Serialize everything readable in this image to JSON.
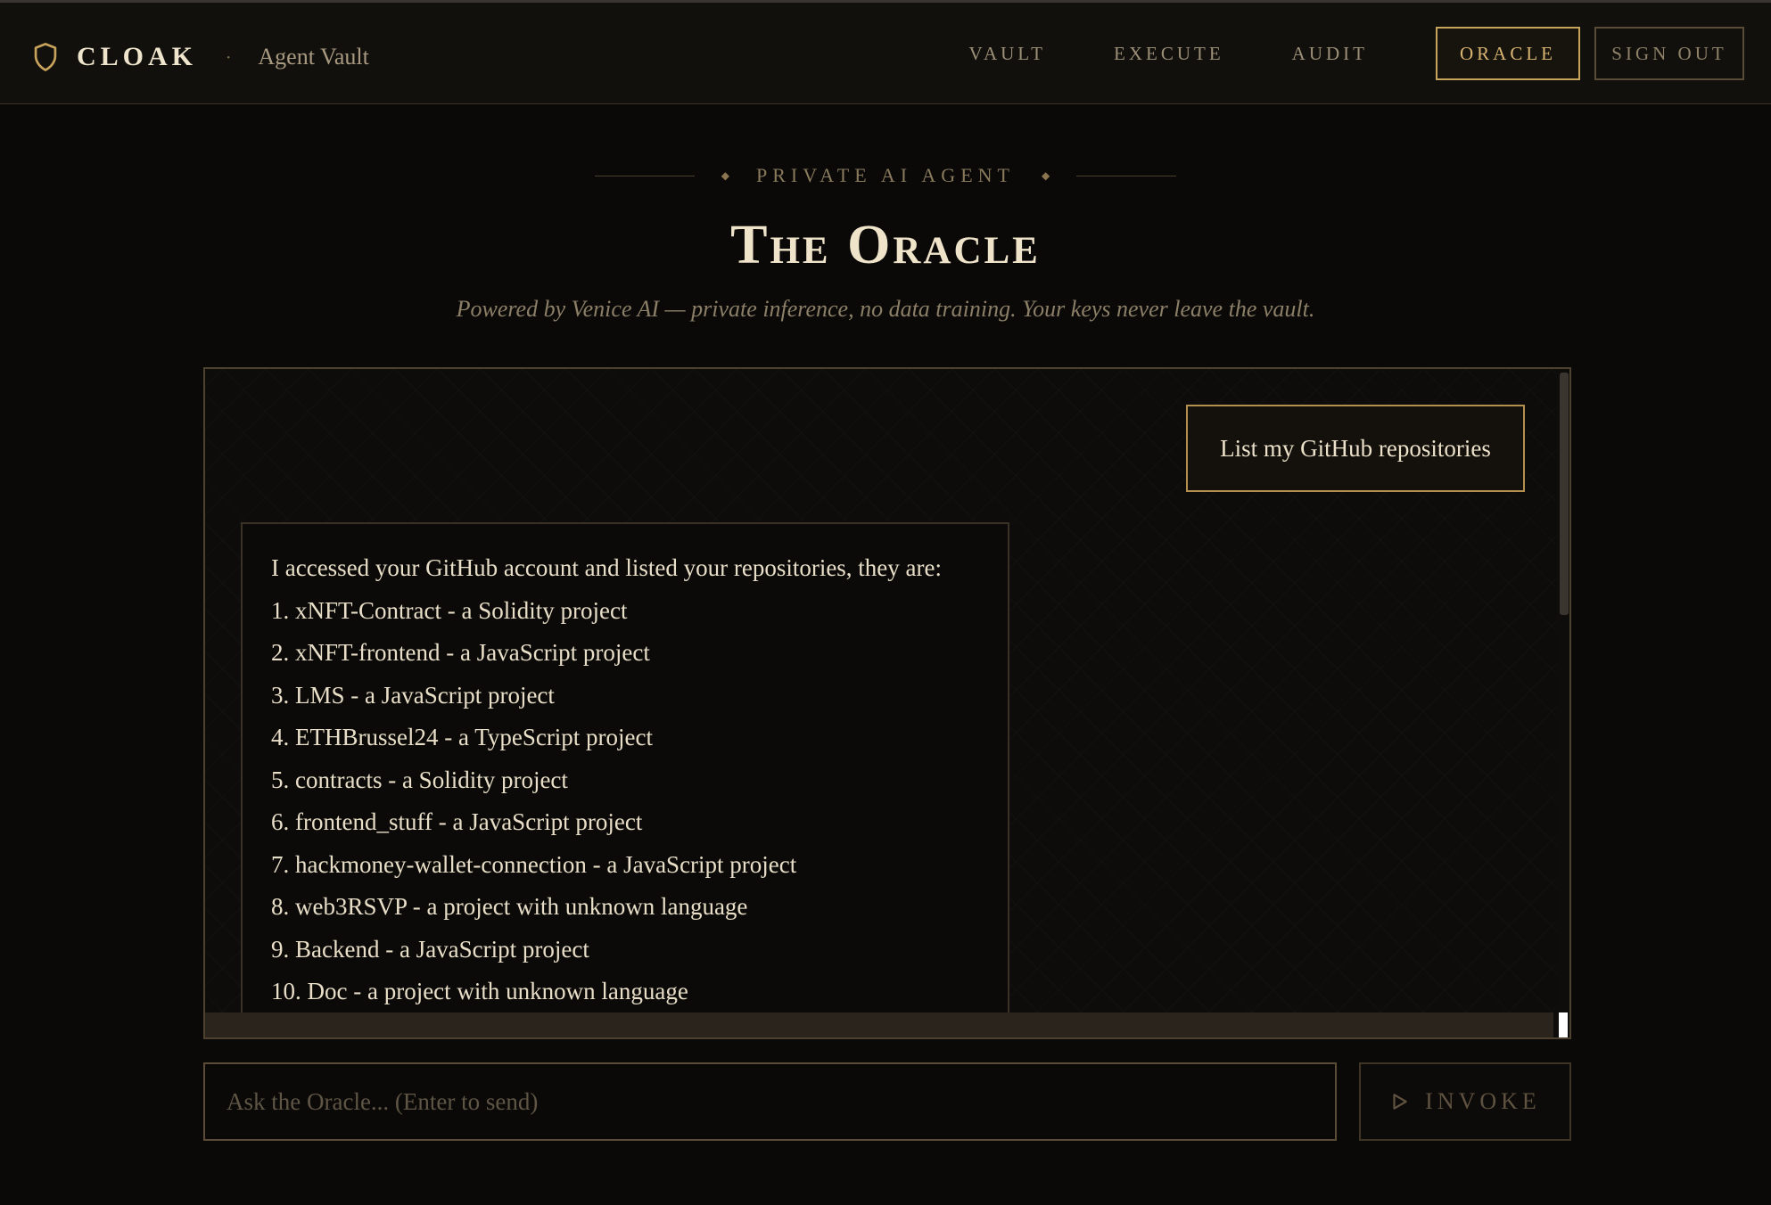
{
  "brand": {
    "name": "CLOAK",
    "separator": "·",
    "subtitle": "Agent Vault"
  },
  "nav": {
    "items": [
      "VAULT",
      "EXECUTE",
      "AUDIT"
    ],
    "active": "ORACLE",
    "signout": "SIGN OUT"
  },
  "header": {
    "eyebrow": "PRIVATE AI AGENT",
    "title": "The Oracle",
    "subtitle": "Powered by Venice AI — private inference, no data training. Your keys never leave the vault."
  },
  "chat": {
    "user_message": "List my GitHub repositories",
    "assistant_lines": [
      "I accessed your GitHub account and listed your repositories, they are:",
      "1. xNFT-Contract - a Solidity project",
      "2. xNFT-frontend - a JavaScript project",
      "3. LMS - a JavaScript project",
      "4. ETHBrussel24 - a TypeScript project",
      "5. contracts - a Solidity project",
      "6. frontend_stuff - a JavaScript project",
      "7. hackmoney-wallet-connection - a JavaScript project",
      "8. web3RSVP - a project with unknown language",
      "9. Backend - a JavaScript project",
      "10. Doc - a project with unknown language"
    ]
  },
  "composer": {
    "placeholder": "Ask the Oracle... (Enter to send)",
    "value": "",
    "invoke_label": "INVOKE"
  },
  "icons": {
    "brand": "shield-icon",
    "invoke": "play-icon"
  },
  "colors": {
    "background": "#0a0908",
    "accent_gold": "#c8a35c",
    "text": "#e8dcc2"
  }
}
